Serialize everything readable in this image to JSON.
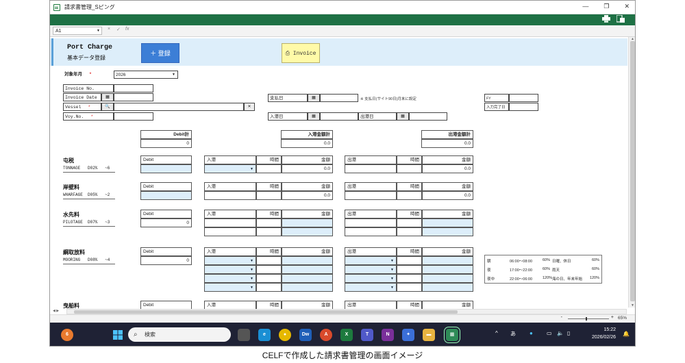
{
  "window": {
    "title": "請求書管理_Sピング",
    "minimize": "—",
    "restore": "❐",
    "close": "✕"
  },
  "ribbon": {
    "print_icon": "printer-icon",
    "export_icon": "export-icon"
  },
  "formula_bar": {
    "cell_ref": "A1",
    "cancel": "×",
    "confirm": "✓",
    "fx": "fx"
  },
  "header": {
    "title": "Port Charge",
    "subtitle": "基本データ登録",
    "register_button": "＋ 登録",
    "invoice_button": "⎙ Invoice"
  },
  "form": {
    "target_month_label": "対象年月",
    "required_mark": "*",
    "target_month_value": "2026",
    "invoice_no_label": "Invoice No.",
    "invoice_date_label": "Invoice Date",
    "vessel_label": "Vessel",
    "vessel_clear": "✕",
    "voy_label": "Voy.No.",
    "payment_date_label": "支払日",
    "payment_note": "※ 支払日(サイト90日)月末に設定",
    "arrival_date_label": "入港日",
    "departure_date_label": "出港日",
    "fy_label": "FY",
    "input_done_label": "入力完了日"
  },
  "totals": {
    "debit_label": "Debit計",
    "debit_value": "0",
    "in_label": "入港金額計",
    "in_value": "0.0",
    "out_label": "出港金額計",
    "out_value": "0.0"
  },
  "col_headers": {
    "debit": "Debit",
    "in": "入港",
    "out": "出港",
    "time": "時間",
    "amount": "金額"
  },
  "sections": [
    {
      "title": "屯税",
      "code": "TONNAGE   D02%   ~6",
      "debit": "",
      "in_amount": "0.0",
      "out_amount": "0.0"
    },
    {
      "title": "岸壁料",
      "code": "WHARFAGE  D05%   ~2",
      "debit": "",
      "in_amount": "0.0",
      "out_amount": "0.0"
    },
    {
      "title": "水先料",
      "code": "PILOTAGE  D07%   ~3",
      "debit": "0",
      "in_amount": "",
      "out_amount": ""
    },
    {
      "title": "綱取放料",
      "code": "MOORING   D08%   ~4",
      "debit": "0",
      "in_amount": "",
      "out_amount": ""
    },
    {
      "title": "曳船料",
      "code": "",
      "debit": "",
      "in_amount": "",
      "out_amount": ""
    }
  ],
  "rate_table": [
    {
      "name": "朝",
      "time": "06:00～08:00",
      "rate1": "60%",
      "cond": "日曜、休日",
      "rate2": "60%"
    },
    {
      "name": "夜",
      "time": "17:00～22:00",
      "rate1": "60%",
      "cond": "雨天",
      "rate2": "60%"
    },
    {
      "name": "夜中",
      "time": "22:00～06:00",
      "rate1": "120%",
      "cond": "海の日、年末年始",
      "rate2": "120%"
    }
  ],
  "statusbar": {
    "zoom": "65%",
    "zoom_minus": "-",
    "zoom_plus": "+"
  },
  "taskbar": {
    "search": "検索",
    "time": "15:22",
    "date": "2026/02/26",
    "ime": "あ",
    "badge": "6"
  },
  "caption": "CELFで作成した請求書管理の画面イメージ"
}
